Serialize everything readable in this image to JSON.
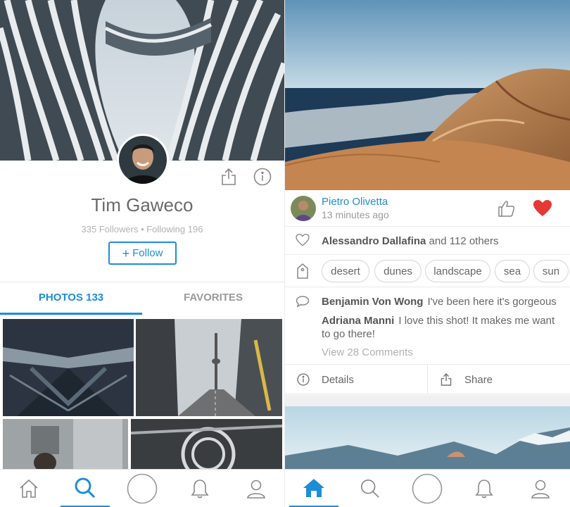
{
  "profile": {
    "name": "Tim Gaweco",
    "stats": "335 Followers • Following 196",
    "follow_label": "Follow",
    "follow_plus": "+"
  },
  "profile_tabs": {
    "photos": "PHOTOS 133",
    "favorites": "FAVORITES"
  },
  "post": {
    "author": "Pietro Olivetta",
    "time": "13 minutes ago",
    "likes_name": "Alessandro Dallafina",
    "likes_rest": " and 112 others",
    "liked": true,
    "tags": [
      "desert",
      "dunes",
      "landscape",
      "sea",
      "sun"
    ],
    "comments": [
      {
        "author": "Benjamin Von Wong",
        "text": "I've been here it's gorgeous"
      },
      {
        "author": "Adriana Manni",
        "text": "I love this shot! It makes me want to go there!"
      }
    ],
    "view_comments": "View 28 Comments",
    "details_label": "Details",
    "share_label": "Share"
  },
  "colors": {
    "accent": "#1d8dd8",
    "heart": "#e53935"
  },
  "icons": {
    "left_tabbar": [
      "home-icon",
      "search-icon",
      "camera-circle-icon",
      "bell-icon",
      "user-icon"
    ],
    "right_tabbar": [
      "home-icon",
      "search-icon",
      "camera-circle-icon",
      "bell-icon",
      "user-icon"
    ]
  }
}
